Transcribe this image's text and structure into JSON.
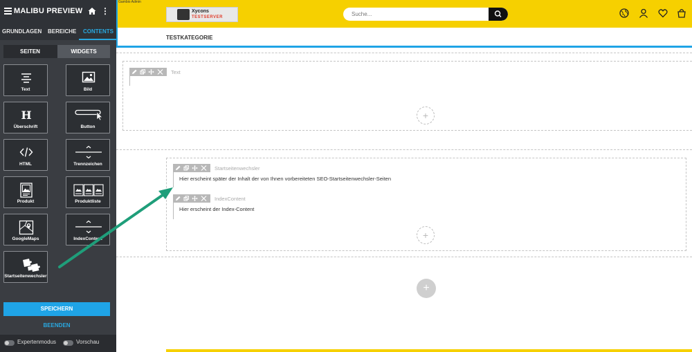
{
  "sidebar": {
    "title": "MALIBU PREVIEW",
    "tabs": [
      {
        "label": "GRUNDLAGEN"
      },
      {
        "label": "BEREICHE"
      },
      {
        "label": "CONTENTS"
      }
    ],
    "sub_tabs": [
      {
        "label": "SEITEN"
      },
      {
        "label": "WIDGETS"
      }
    ],
    "widgets": [
      {
        "label": "Text",
        "icon": "text-lines-icon"
      },
      {
        "label": "Bild",
        "icon": "image-icon"
      },
      {
        "label": "Überschrift",
        "icon": "heading-icon"
      },
      {
        "label": "Button",
        "icon": "button-cursor-icon"
      },
      {
        "label": "HTML",
        "icon": "code-icon"
      },
      {
        "label": "Trennzeichen",
        "icon": "divider-icon"
      },
      {
        "label": "Produkt",
        "icon": "product-icon"
      },
      {
        "label": "Produktliste",
        "icon": "product-list-icon"
      },
      {
        "label": "GoogleMaps",
        "icon": "map-icon"
      },
      {
        "label": "IndexContent",
        "icon": "divider-icon"
      },
      {
        "label": "Startseitenwechsler",
        "icon": "puzzle-icon"
      }
    ],
    "save_label": "SPEICHERN",
    "end_label": "BEENDEN",
    "expert_label": "Expertenmodus",
    "preview_label": "Vorschau"
  },
  "admin_strip": "Gambio Admin",
  "header": {
    "logo_line1": "Xycons",
    "logo_line2": "TESTSERVER",
    "search_placeholder": "Suche...",
    "nav_item": "TESTKATEGORIE"
  },
  "content": {
    "widget_text_label": "Text",
    "widget_switcher_label": "Startseitenwechsler",
    "widget_switcher_text": "Hier erscheint später der Inhalt der von Ihnen vorbereiteten SEO-Startseitenwechsler-Seiten",
    "widget_index_label": "IndexContent",
    "widget_index_text": "Hier erscheint der Index-Content",
    "add_symbol": "+"
  },
  "colors": {
    "header_yellow": "#f6d000",
    "accent_blue": "#1fa4e6",
    "sidebar_bg": "#3a3d42",
    "arrow_green": "#1f9e7a"
  }
}
